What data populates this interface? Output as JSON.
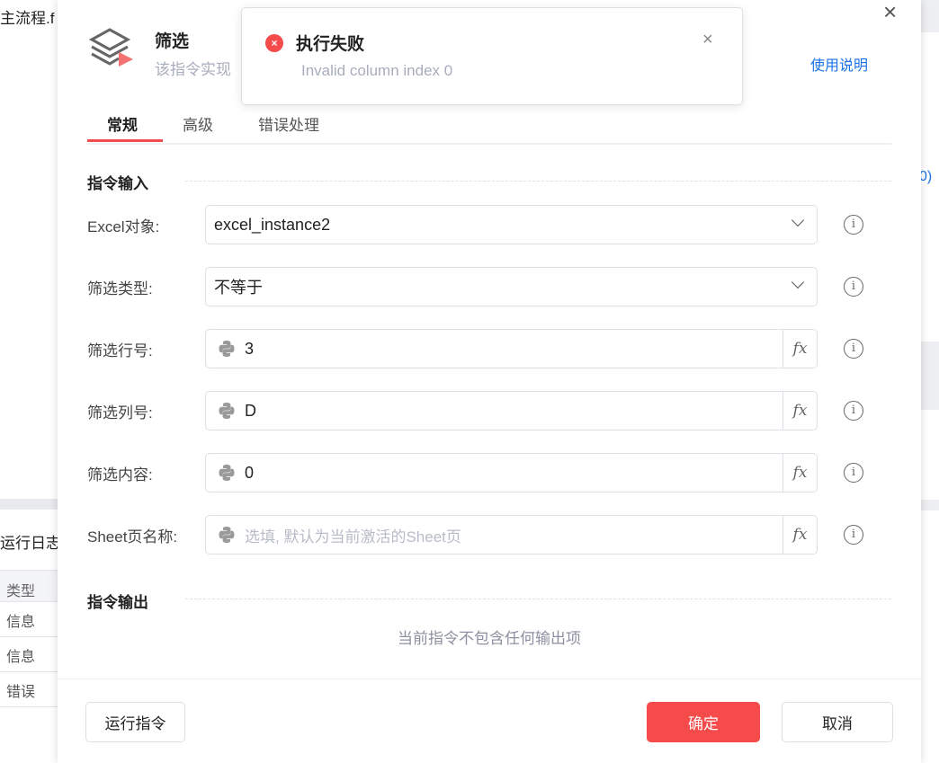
{
  "background": {
    "file_title": "主流程.f",
    "log_title": "运行日志",
    "right_text": "0)",
    "log_table": {
      "header": "类型",
      "rows": [
        "信息",
        "信息",
        "错误"
      ]
    }
  },
  "dialog": {
    "title": "筛选",
    "subtitle": "该指令实现",
    "help_link": "使用说明",
    "close_icon": "×",
    "tabs": [
      {
        "label": "常规",
        "active": true
      },
      {
        "label": "高级"
      },
      {
        "label": "错误处理"
      }
    ],
    "input_section": "指令输入",
    "fields": [
      {
        "label": "Excel对象:",
        "value": "excel_instance2",
        "type": "select"
      },
      {
        "label": "筛选类型:",
        "value": "不等于",
        "type": "select"
      },
      {
        "label": "筛选行号:",
        "value": "3",
        "type": "expr"
      },
      {
        "label": "筛选列号:",
        "value": "D",
        "type": "expr"
      },
      {
        "label": "筛选内容:",
        "value": "0",
        "type": "expr"
      },
      {
        "label": "Sheet页名称:",
        "value": "",
        "placeholder": "选填, 默认为当前激活的Sheet页",
        "type": "expr"
      }
    ],
    "fx_label": "fx",
    "info_glyph": "i",
    "output_section": "指令输出",
    "output_empty": "当前指令不包含任何输出项",
    "buttons": {
      "run": "运行指令",
      "ok": "确定",
      "cancel": "取消"
    }
  },
  "toast": {
    "title": "执行失败",
    "message": "Invalid column index 0",
    "error_glyph": "×",
    "close_glyph": "×"
  },
  "colors": {
    "primary": "#f54b4b",
    "link": "#1a73e8"
  }
}
